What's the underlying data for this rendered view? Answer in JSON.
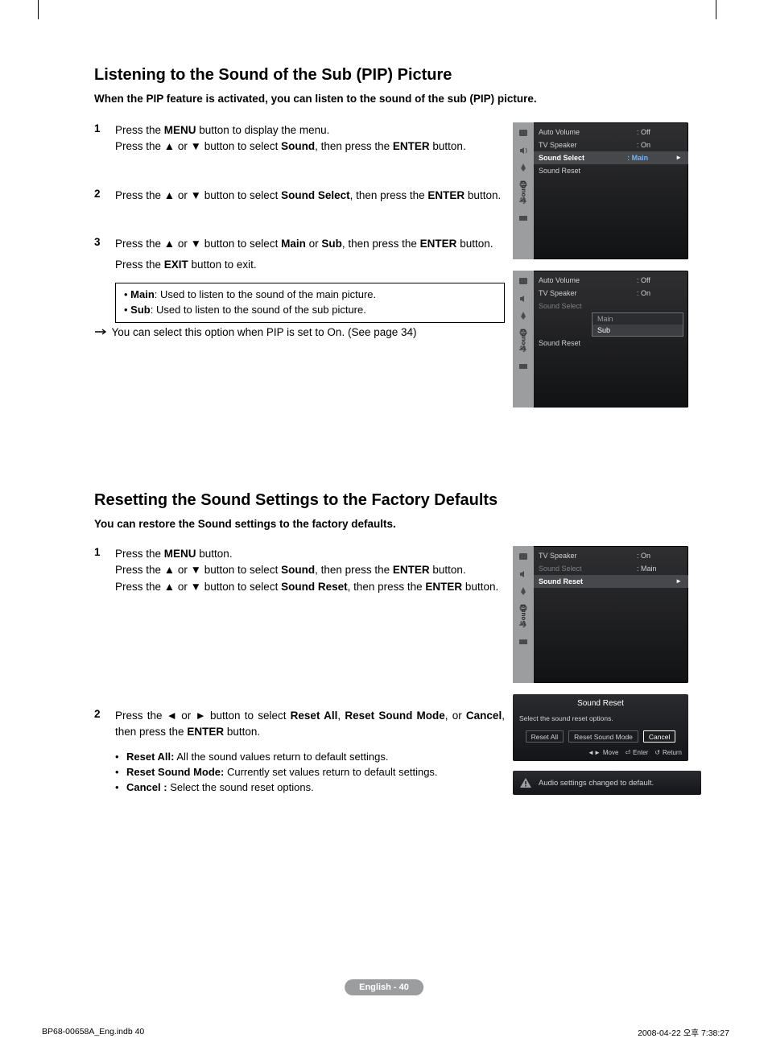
{
  "section1": {
    "title": "Listening to the Sound of the Sub (PIP) Picture",
    "lede": "When the PIP feature is activated, you can listen to the sound of the sub (PIP) picture.",
    "step1_a": "Press the ",
    "step1_b": " button to display the menu.",
    "step1_c": "Press the ▲ or ▼ button to select ",
    "step1_d": ", then press the ",
    "step1_e": " button.",
    "step2_a": "Press the ▲ or ▼ button to select ",
    "step2_b": ", then press the ",
    "step2_c": " button.",
    "step3_a": "Press the ▲ or ▼ button to select ",
    "step3_b": " or ",
    "step3_c": ", then press the ",
    "step3_d": " button.",
    "step3_e": "Press the ",
    "step3_f": " button to exit.",
    "note_main_bold": "Main",
    "note_main_rest": ": Used to listen to the sound of the main picture.",
    "note_sub_bold": "Sub",
    "note_sub_rest": ": Used to listen to the sound of the sub picture.",
    "after_note": "You can select this option when PIP is set to On. (See page 34)",
    "buttons": {
      "menu": "MENU",
      "enter": "ENTER",
      "exit": "EXIT"
    },
    "menu_words": {
      "sound": "Sound",
      "sound_select": "Sound Select",
      "main": "Main",
      "sub": "Sub"
    }
  },
  "osd": {
    "tab_label": "Sound",
    "menu1": {
      "rows": [
        {
          "label": "Auto Volume",
          "val": ": Off"
        },
        {
          "label": "TV Speaker",
          "val": ": On"
        },
        {
          "label": "Sound Select",
          "val": ": Main",
          "selected": true
        },
        {
          "label": "Sound Reset",
          "val": ""
        }
      ]
    },
    "menu2": {
      "rows": [
        {
          "label": "Auto Volume",
          "val": ": Off"
        },
        {
          "label": "TV Speaker",
          "val": ": On"
        },
        {
          "label": "Sound Select",
          "val": "",
          "dim": true
        },
        {
          "label": "Sound Reset",
          "val": ""
        }
      ],
      "dropdown": [
        "Main",
        "Sub"
      ],
      "dropdown_selected": "Sub"
    },
    "menu3": {
      "rows": [
        {
          "label": "TV Speaker",
          "val": ": On"
        },
        {
          "label": "Sound Select",
          "val": ": Main",
          "dim": true
        },
        {
          "label": "Sound Reset",
          "val": "",
          "selected": true
        }
      ]
    }
  },
  "section2": {
    "title": "Resetting the Sound Settings to the Factory Defaults",
    "lede": "You can restore the Sound settings to the factory defaults.",
    "step1_a": "Press the ",
    "step1_b": " button.",
    "step1_c": "Press the ▲ or ▼ button to select ",
    "step1_d": ", then press the ",
    "step1_e": " button.",
    "step1_f": "Press the ▲ or ▼ button to select ",
    "step1_g": ", then press the ",
    "step1_h": " button.",
    "step2_a": "Press the ◄ or ► button to select ",
    "step2_b": ", ",
    "step2_c": ", or ",
    "step2_d": ", then press the ",
    "step2_e": " button.",
    "bullet1_bold": "Reset All:",
    "bullet1_rest": " All the sound values return to default settings.",
    "bullet2_bold": "Reset Sound Mode:",
    "bullet2_rest": " Currently set values return to default settings.",
    "bullet3_bold": "Cancel :",
    "bullet3_rest": " Select the sound reset options.",
    "menu_words": {
      "sound": "Sound",
      "sound_reset": "Sound Reset",
      "reset_all": "Reset All",
      "reset_sound_mode": "Reset Sound Mode",
      "cancel": "Cancel"
    }
  },
  "dialog": {
    "title": "Sound Reset",
    "msg": "Select the sound reset options.",
    "btns": [
      "Reset All",
      "Reset Sound Mode",
      "Cancel"
    ],
    "selected": "Cancel",
    "legend": {
      "move": "Move",
      "enter": "Enter",
      "return": "Return"
    }
  },
  "toast": "Audio settings changed to default.",
  "page_badge": "English - 40",
  "footer": {
    "left": "BP68-00658A_Eng.indb   40",
    "right": "2008-04-22   오후 7:38:27"
  }
}
